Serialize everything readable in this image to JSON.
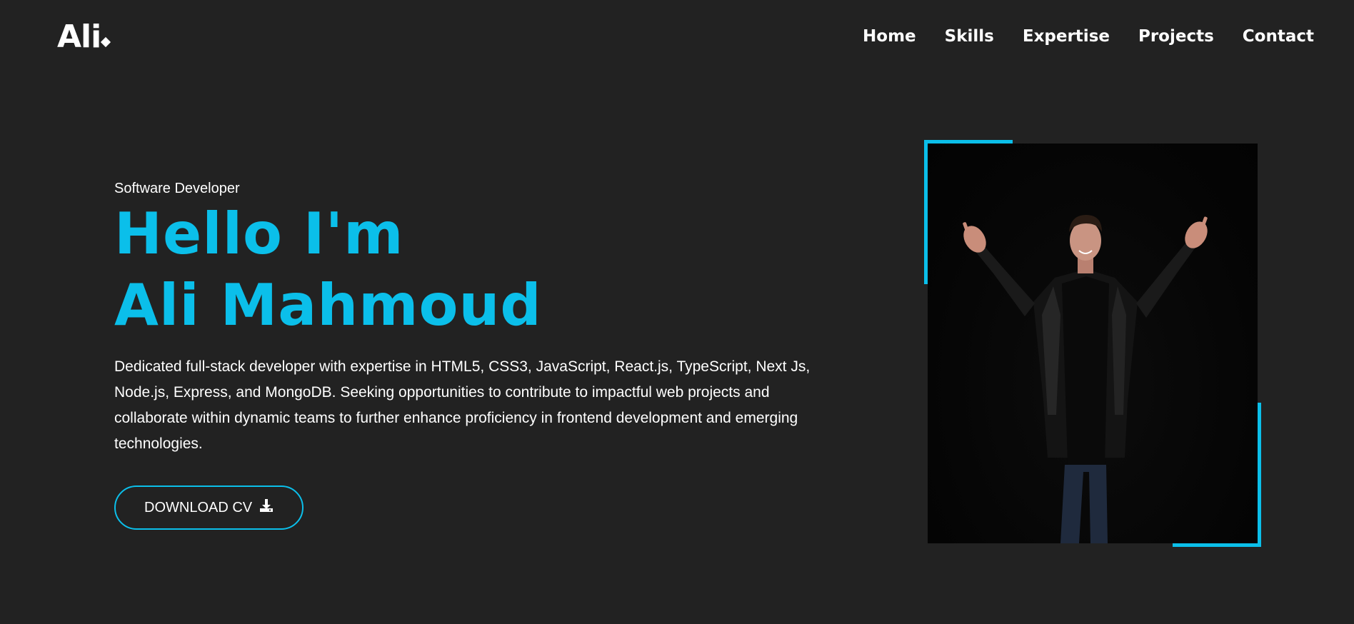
{
  "logo": {
    "text": "Ali"
  },
  "nav": {
    "items": [
      "Home",
      "Skills",
      "Expertise",
      "Projects",
      "Contact"
    ]
  },
  "hero": {
    "role": "Software Developer",
    "greeting": "Hello I'm",
    "name": "Ali Mahmoud",
    "description": "Dedicated full-stack developer with expertise in HTML5, CSS3, JavaScript, React.js, TypeScript, Next Js, Node.js, Express, and MongoDB. Seeking opportunities to contribute to impactful web projects and collaborate within dynamic teams to further enhance proficiency in frontend development and emerging technologies.",
    "cv_button": "DOWNLOAD CV"
  },
  "colors": {
    "background": "#222222",
    "accent": "#0bbfea",
    "text": "#ffffff"
  },
  "icons": {
    "cv_button": "download-icon"
  }
}
